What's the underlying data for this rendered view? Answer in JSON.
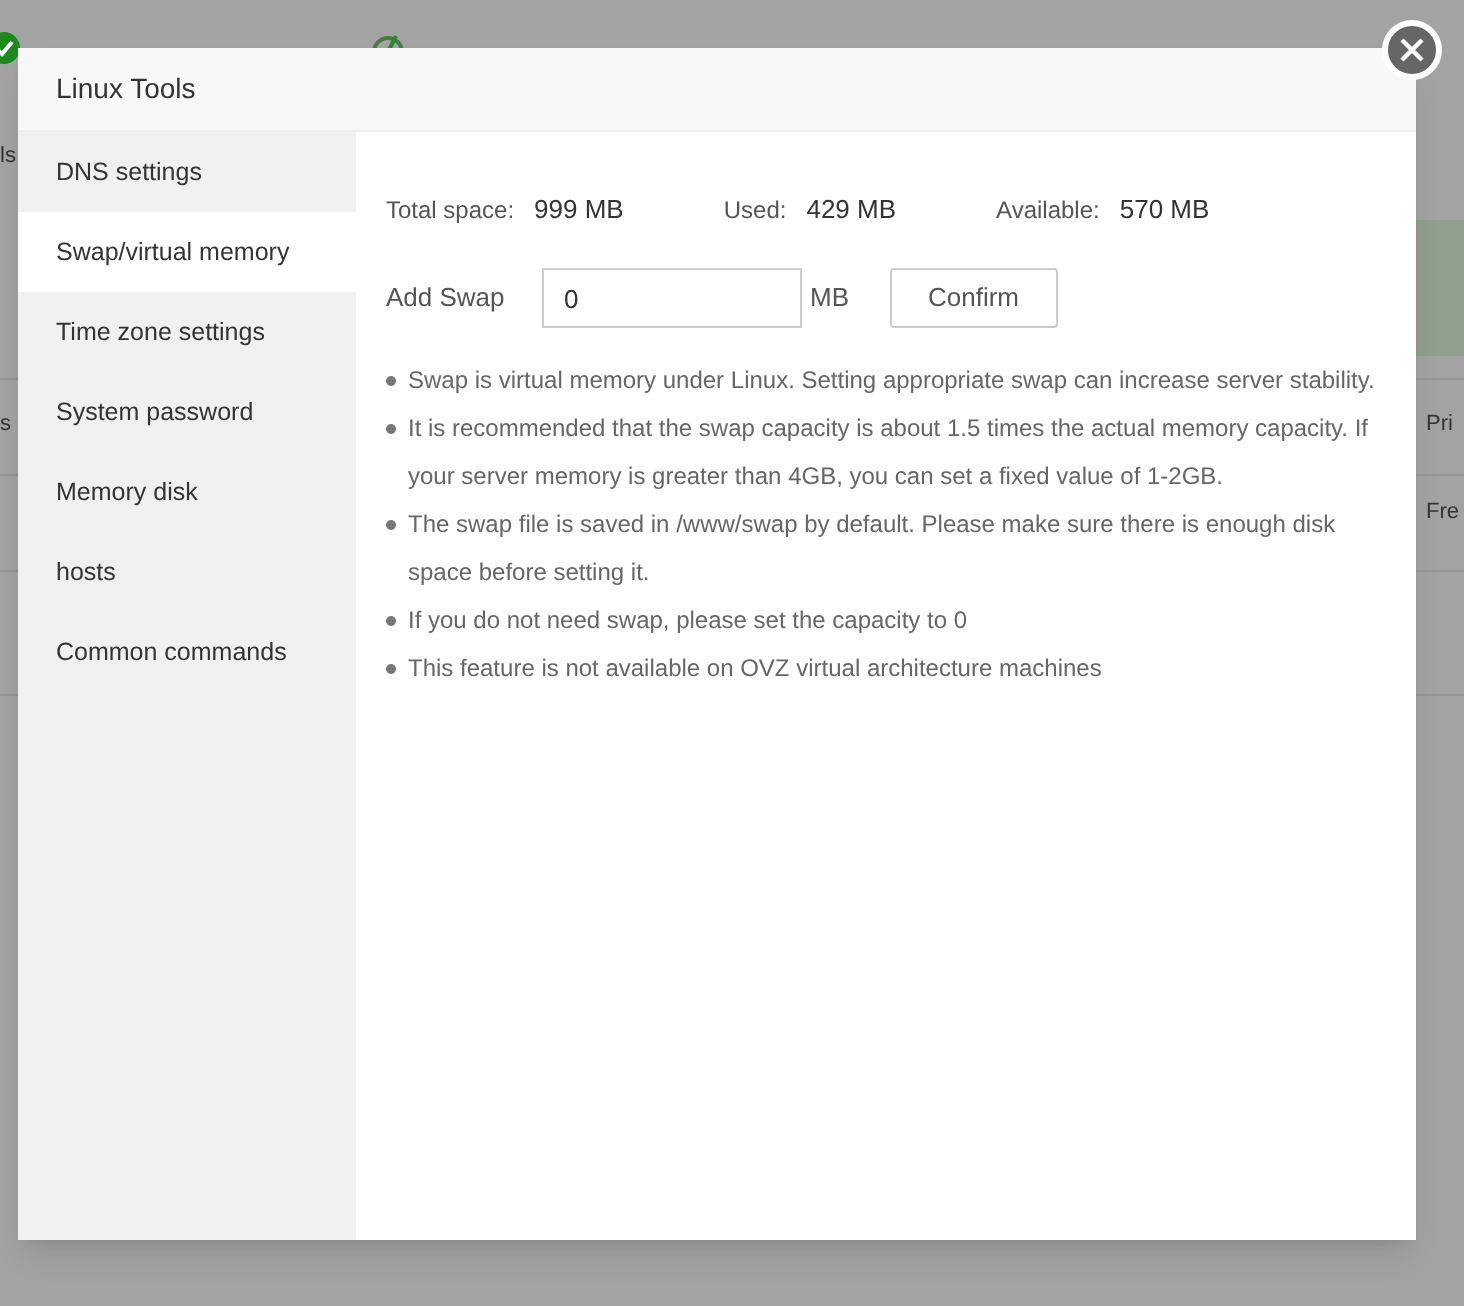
{
  "background": {
    "left_fragments": [
      "ls",
      "s"
    ],
    "right_fragments": [
      "Pri",
      "Fre"
    ]
  },
  "dialog": {
    "title": "Linux Tools",
    "sidebar": {
      "items": [
        {
          "label": "DNS settings",
          "selected": false
        },
        {
          "label": "Swap/virtual memory",
          "selected": true
        },
        {
          "label": "Time zone settings",
          "selected": false
        },
        {
          "label": "System password",
          "selected": false
        },
        {
          "label": "Memory disk",
          "selected": false
        },
        {
          "label": "hosts",
          "selected": false
        },
        {
          "label": "Common commands",
          "selected": false
        }
      ]
    },
    "stats": [
      {
        "label": "Total space:",
        "value": "999 MB"
      },
      {
        "label": "Used:",
        "value": "429 MB"
      },
      {
        "label": "Available:",
        "value": "570 MB"
      }
    ],
    "add_swap": {
      "label": "Add Swap",
      "value": "0",
      "unit": "MB",
      "button": "Confirm"
    },
    "notes": [
      "Swap is virtual memory under Linux. Setting appropriate swap can increase server stability.",
      "It is recommended that the swap capacity is about 1.5 times the actual memory capacity. If your server memory is greater than 4GB, you can set a fixed value of 1-2GB.",
      "The swap file is saved in /www/swap by default. Please make sure there is enough disk space before setting it.",
      "If you do not need swap, please set the capacity to 0",
      "This feature is not available on OVZ virtual architecture machines"
    ]
  }
}
